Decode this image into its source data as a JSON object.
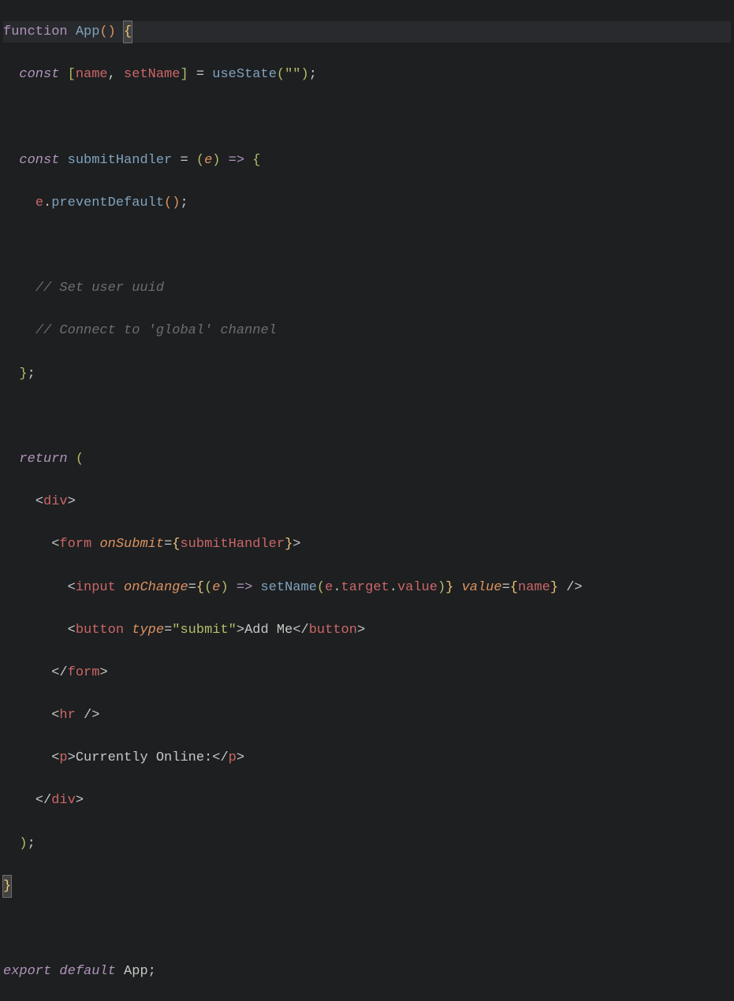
{
  "code": {
    "l1": {
      "function": "function",
      "app": "App",
      "p1": "(",
      "p2": ")",
      "sp": " ",
      "brace": "{"
    },
    "l2": {
      "const": "const",
      "lb": "[",
      "name": "name",
      "comma": ",",
      "setName": "setName",
      "rb": "]",
      "eq": "=",
      "useState": "useState",
      "lp": "(",
      "str": "\"\"",
      "rp": ")",
      "semi": ";"
    },
    "l3": {
      "const": "const",
      "submitHandler": "submitHandler",
      "eq": "=",
      "lp": "(",
      "e": "e",
      "rp": ")",
      "arrow": "=>",
      "brace": "{"
    },
    "l4": {
      "e": "e",
      "dot": ".",
      "method": "preventDefault",
      "lp": "(",
      "rp": ")",
      "semi": ";"
    },
    "l5": {
      "comment": "// Set user uuid"
    },
    "l6": {
      "comment": "// Connect to 'global' channel"
    },
    "l7": {
      "brace": "}",
      "semi": ";"
    },
    "l8": {
      "return": "return",
      "lp": "("
    },
    "l9": {
      "lt": "<",
      "tag": "div",
      "gt": ">"
    },
    "l10": {
      "lt": "<",
      "tag": "form",
      "attr": "onSubmit",
      "eq": "=",
      "lb": "{",
      "val": "submitHandler",
      "rb": "}",
      "gt": ">"
    },
    "l11": {
      "lt": "<",
      "tag": "input",
      "attr1": "onChange",
      "eq1": "=",
      "lb1": "{",
      "lp": "(",
      "e": "e",
      "rp": ")",
      "arrow": "=>",
      "setName": "setName",
      "lp2": "(",
      "e2": "e",
      "dot1": ".",
      "target": "target",
      "dot2": ".",
      "value": "value",
      "rp2": ")",
      "rb1": "}",
      "attr2": "value",
      "eq2": "=",
      "lb2": "{",
      "name": "name",
      "rb2": "}",
      "slash": "/",
      "gt": ">"
    },
    "l12": {
      "lt": "<",
      "tag": "button",
      "attr": "type",
      "eq": "=",
      "str": "\"submit\"",
      "gt": ">",
      "text": "Add Me",
      "lt2": "<",
      "slash": "/",
      "tag2": "button",
      "gt2": ">"
    },
    "l13": {
      "lt": "<",
      "slash": "/",
      "tag": "form",
      "gt": ">"
    },
    "l14": {
      "lt": "<",
      "tag": "hr",
      "slash": "/",
      "gt": ">"
    },
    "l15": {
      "lt": "<",
      "tag": "p",
      "gt": ">",
      "text": "Currently Online:",
      "lt2": "<",
      "slash": "/",
      "tag2": "p",
      "gt2": ">"
    },
    "l16": {
      "lt": "<",
      "slash": "/",
      "tag": "div",
      "gt": ">"
    },
    "l17": {
      "rp": ")",
      "semi": ";"
    },
    "l18": {
      "brace": "}"
    },
    "l19": {
      "export": "export",
      "default": "default",
      "app": "App",
      "semi": ";"
    }
  }
}
